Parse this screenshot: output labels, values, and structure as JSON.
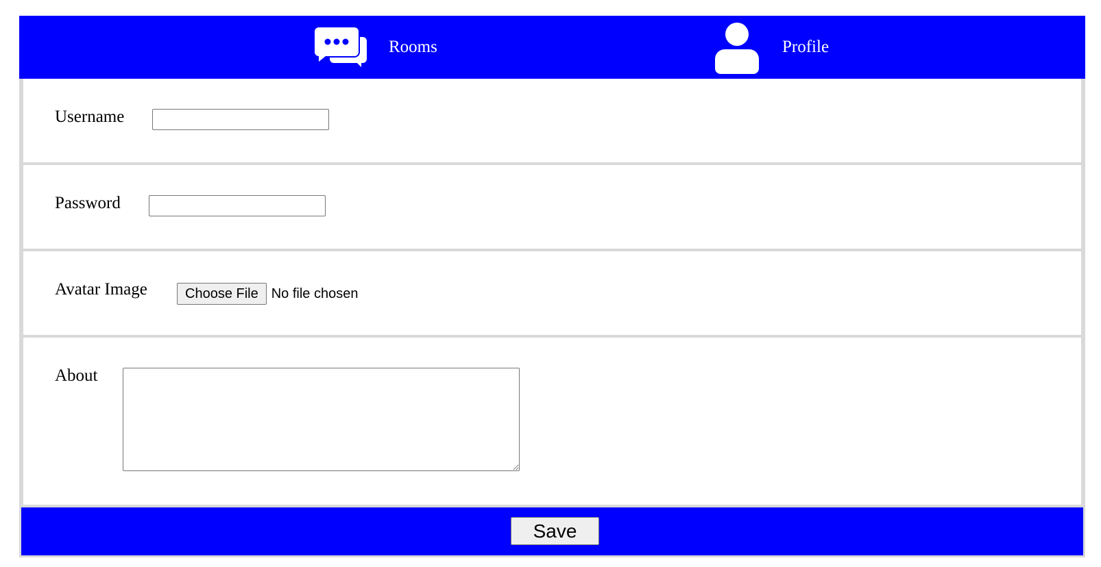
{
  "nav": {
    "items": [
      {
        "label": "Rooms",
        "icon": "chat-bubbles-icon"
      },
      {
        "label": "Profile",
        "icon": "user-icon"
      }
    ],
    "background": "#0000ff",
    "text_color": "#ffffff"
  },
  "form": {
    "username": {
      "label": "Username",
      "value": "",
      "placeholder": ""
    },
    "password": {
      "label": "Password",
      "value": "",
      "placeholder": ""
    },
    "avatar": {
      "label": "Avatar Image",
      "button_label": "Choose File",
      "status": "No file chosen"
    },
    "about": {
      "label": "About",
      "value": "",
      "placeholder": ""
    },
    "row_divider_color": "#d9d9d9"
  },
  "footer": {
    "save_label": "Save",
    "background": "#0000ff"
  }
}
